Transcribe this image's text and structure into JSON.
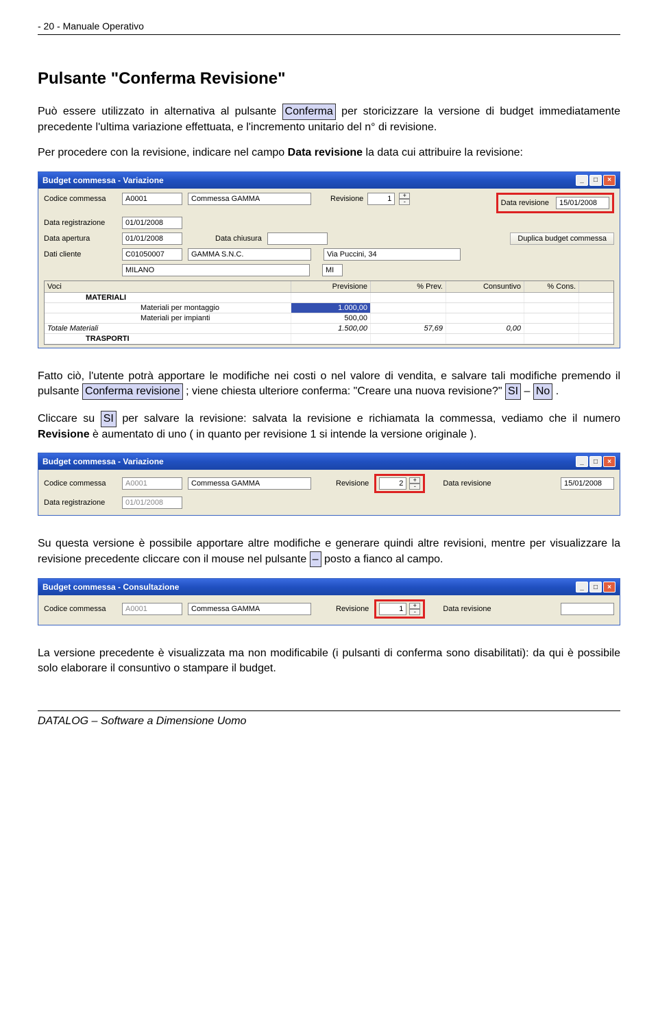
{
  "doc": {
    "header_left": "- 20 -  Manuale Operativo",
    "section_title": "Pulsante \"Conferma Revisione\"",
    "p1a": "Può essere utilizzato in alternativa al pulsante ",
    "p1_hl": "Conferma",
    "p1b": " per storicizzare la versione di budget immediatamente precedente l'ultima variazione effettuata,  e l'incremento unitario del n° di revisione.",
    "p2a": "Per procedere con la revisione, indicare nel campo ",
    "p2_bold": "Data revisione",
    "p2b": " la data cui attribuire la revisione:",
    "p3a": "Fatto ciò, l'utente potrà apportare le modifiche nei costi o nel valore di vendita, e salvare tali modifiche premendo il pulsante ",
    "p3_hl1": "Conferma revisione",
    "p3b": " ; viene chiesta ulteriore conferma: \"Creare una nuova revisione?\" ",
    "p3_hl2": "SI",
    "p3c": " – ",
    "p3_hl3": "No",
    "p3d": " .",
    "p4a": "Cliccare su ",
    "p4_hl": "SI",
    "p4b": " per salvare la revisione: salvata la revisione e richiamata la commessa, vediamo che il numero ",
    "p4_bold": "Revisione",
    "p4c": " è aumentato di uno ( in quanto per revisione 1 si intende la versione originale ).",
    "p5a": "Su questa versione è possibile apportare altre modifiche e generare quindi altre revisioni, mentre per visualizzare la revisione precedente cliccare con il mouse nel pulsante ",
    "p5_hl": "–",
    "p5b": " posto a fianco al campo.",
    "p6": "La versione precedente è visualizzata ma non modificabile (i pulsanti di conferma sono disabilitati): da qui è possibile solo elaborare il consuntivo o stampare il budget.",
    "footer": "DATALOG – Software a Dimensione Uomo"
  },
  "win1": {
    "title": "Budget commessa - Variazione",
    "lbl_codice": "Codice commessa",
    "val_codice": "A0001",
    "val_commessa": "Commessa GAMMA",
    "lbl_revisione": "Revisione",
    "val_revisione": "1",
    "lbl_datarev": "Data revisione",
    "val_datarev": "15/01/2008",
    "lbl_datareg": "Data registrazione",
    "val_datareg": "01/01/2008",
    "lbl_dataap": "Data apertura",
    "val_dataap": "01/01/2008",
    "lbl_datach": "Data chiusura",
    "val_datach": "",
    "btn_duplica": "Duplica budget commessa",
    "lbl_daticl": "Dati cliente",
    "val_clicod": "C01050007",
    "val_cliname": "GAMMA S.N.C.",
    "val_cliaddr": "Via Puccini, 34",
    "val_clicity": "MILANO",
    "val_cliprov": "MI",
    "grid_hdr": {
      "c1": "Voci",
      "c2": "Previsione",
      "c3": "% Prev.",
      "c4": "Consuntivo",
      "c5": "% Cons."
    },
    "rows": [
      {
        "voci": "MATERIALI",
        "bold": true
      },
      {
        "voci": "Materiali per montaggio",
        "prev": "1.000,00",
        "indent": true
      },
      {
        "voci": "Materiali per impianti",
        "prev": "500,00",
        "indent": true
      },
      {
        "voci": "Totale Materiali",
        "prev": "1.500,00",
        "pprev": "57,69",
        "cons": "0,00",
        "ital": true
      },
      {
        "voci": "TRASPORTI",
        "bold": true
      }
    ]
  },
  "win2": {
    "title": "Budget commessa - Variazione",
    "lbl_codice": "Codice commessa",
    "val_codice": "A0001",
    "val_commessa": "Commessa GAMMA",
    "lbl_revisione": "Revisione",
    "val_revisione": "2",
    "lbl_datarev": "Data revisione",
    "val_datarev": "15/01/2008",
    "lbl_datareg": "Data registrazione",
    "val_datareg": "01/01/2008"
  },
  "win3": {
    "title": "Budget commessa - Consultazione",
    "lbl_codice": "Codice commessa",
    "val_codice": "A0001",
    "val_commessa": "Commessa GAMMA",
    "lbl_revisione": "Revisione",
    "val_revisione": "1",
    "lbl_datarev": "Data revisione",
    "val_datarev": ""
  }
}
